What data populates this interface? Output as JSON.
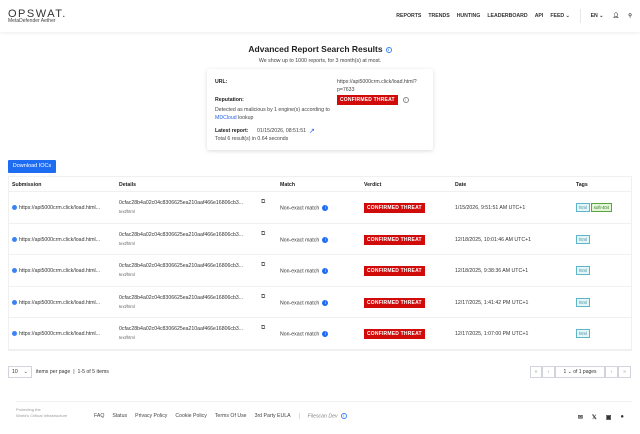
{
  "header": {
    "logo": "OPSWAT.",
    "product": "MetaDefender Aether",
    "nav": [
      "REPORTS",
      "TRENDS",
      "HUNTING",
      "LEADERBOARD",
      "API",
      "FEED"
    ],
    "lang": "EN"
  },
  "page": {
    "title": "Advanced Report Search Results",
    "subtitle": "We show up to 1000 reports, for 3 month(s) at most."
  },
  "summary": {
    "url_label": "URL:",
    "url_line1": "https://api5000crm.click/load.html?",
    "url_line2": "p=7633",
    "reputation_label": "Reputation:",
    "reputation": "CONFIRMED THREAT",
    "detected_pre": "Detected as malicious by 1 engine(s) according",
    "detected_to": "to",
    "detected_link": "MDCloud",
    "detected_post": "lookup",
    "latest_label": "Latest report:",
    "latest_value": "01/15/2026, 08:51:51",
    "total": "Total 6 result(s) in 0.64 seconds"
  },
  "download_label": "Download IOCs",
  "table": {
    "headers": [
      "Submission",
      "Details",
      "Match",
      "Verdict",
      "Date",
      "Tags"
    ],
    "rows": [
      {
        "submission": "https://api5000crm.click/load.html...",
        "hash": "0cfac28b4a02c04c8306625ea210aaf466e16806cb3...",
        "mime": "text/html",
        "match": "Non-exact match",
        "verdict": "CONFIRMED THREAT",
        "date": "1/15/2026, 9:51:51 AM UTC+1",
        "tags": [
          "html",
          "soft-404"
        ]
      },
      {
        "submission": "https://api5000crm.click/load.html...",
        "hash": "0cfac28b4a02c04c8306625ea210aaf466e16806cb3...",
        "mime": "text/html",
        "match": "Non-exact match",
        "verdict": "CONFIRMED THREAT",
        "date": "12/18/2025, 10:01:46 AM UTC+1",
        "tags": [
          "html"
        ]
      },
      {
        "submission": "https://api5000crm.click/load.html...",
        "hash": "0cfac28b4a02c04c8306625ea210aaf466e16806cb3...",
        "mime": "text/html",
        "match": "Non-exact match",
        "verdict": "CONFIRMED THREAT",
        "date": "12/18/2025, 9:38:36 AM UTC+1",
        "tags": [
          "html"
        ]
      },
      {
        "submission": "https://api5000crm.click/load.html...",
        "hash": "0cfac28b4a02c04c8306625ea210aaf466e16806cb3...",
        "mime": "text/html",
        "match": "Non-exact match",
        "verdict": "CONFIRMED THREAT",
        "date": "12/17/2025, 1:41:42 PM UTC+1",
        "tags": [
          "html"
        ]
      },
      {
        "submission": "https://api5000crm.click/load.html...",
        "hash": "0cfac28b4a02c04c8306625ea210aaf466e16806cb3...",
        "mime": "text/html",
        "match": "Non-exact match",
        "verdict": "CONFIRMED THREAT",
        "date": "12/17/2025, 1:07:00 PM UTC+1",
        "tags": [
          "html"
        ]
      }
    ]
  },
  "pagination": {
    "per_page": "10",
    "per_page_label": "items per page",
    "range": "1-5 of 5 items",
    "page": "1",
    "of_pages": "of 1 pages"
  },
  "footer": {
    "tagline1": "Protecting the",
    "tagline2": "World's Critical Infrastructure",
    "links": [
      "FAQ",
      "Status",
      "Privacy Policy",
      "Cookie Policy",
      "Terms Of Use",
      "3rd Party EULA"
    ],
    "filescan": "Filescan Dev"
  },
  "colors": {
    "accent": "#1d6cf2",
    "threat": "#d10a0a"
  }
}
